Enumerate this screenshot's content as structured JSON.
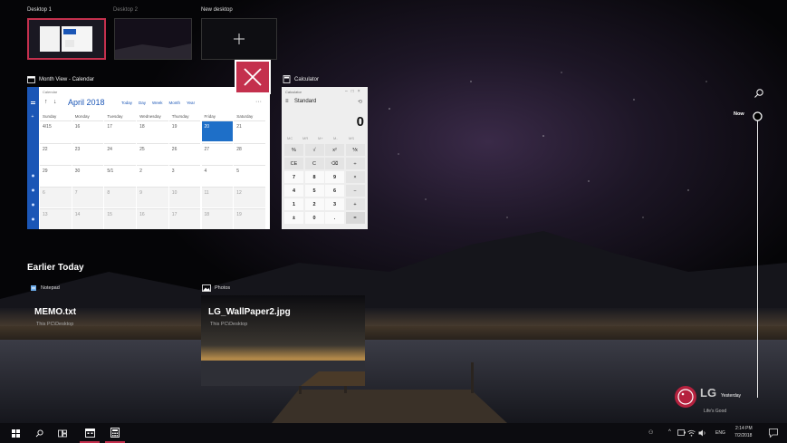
{
  "desktops": {
    "items": [
      {
        "label": "Desktop 1"
      },
      {
        "label": "Desktop 2"
      },
      {
        "label": "New desktop"
      }
    ]
  },
  "windows": {
    "calendar": {
      "title": "Month View - Calendar",
      "app_small": "Calendar",
      "month": "April 2018",
      "view_buttons": [
        "Today",
        "Day",
        "Week",
        "Month",
        "Year"
      ],
      "weekdays": [
        "Sunday",
        "Monday",
        "Tuesday",
        "Wednesday",
        "Thursday",
        "Friday",
        "Saturday"
      ],
      "weeks": [
        [
          "4/15",
          "16",
          "17",
          "18",
          "19",
          "20",
          "21"
        ],
        [
          "22",
          "23",
          "24",
          "25",
          "26",
          "27",
          "28"
        ],
        [
          "29",
          "30",
          "5/1",
          "2",
          "3",
          "4",
          "5"
        ],
        [
          "6",
          "7",
          "8",
          "9",
          "10",
          "11",
          "12"
        ],
        [
          "13",
          "14",
          "15",
          "16",
          "17",
          "18",
          "19"
        ]
      ]
    },
    "calculator": {
      "title": "Calculator",
      "app_small": "Calculator",
      "mode": "Standard",
      "display": "0",
      "memory_row": [
        "MC",
        "MR",
        "M+",
        "M-",
        "MS"
      ],
      "keys": [
        [
          "%",
          "√",
          "x²",
          "⅟x"
        ],
        [
          "CE",
          "C",
          "⌫",
          "÷"
        ],
        [
          "7",
          "8",
          "9",
          "×"
        ],
        [
          "4",
          "5",
          "6",
          "−"
        ],
        [
          "1",
          "2",
          "3",
          "+"
        ],
        [
          "±",
          "0",
          ".",
          "="
        ]
      ]
    }
  },
  "earlier": {
    "heading": "Earlier Today",
    "items": [
      {
        "app": "Notepad",
        "title": "MEMO.txt",
        "path": "This PC\\Desktop"
      },
      {
        "app": "Photos",
        "title": "LG_WallPaper2.jpg",
        "path": "This PC\\Desktop"
      }
    ]
  },
  "timeline": {
    "now_label": "Now",
    "yesterday_label": "Yesterday"
  },
  "watermark": {
    "brand": "LG",
    "tagline": "Life's Good"
  },
  "taskbar": {
    "lang": "ENG",
    "time": "2:14 PM",
    "date": "7/2/2018"
  },
  "colors": {
    "accent": "#c4304d",
    "calendar_blue": "#1b56b6",
    "selected_day": "#1e6fc8"
  }
}
